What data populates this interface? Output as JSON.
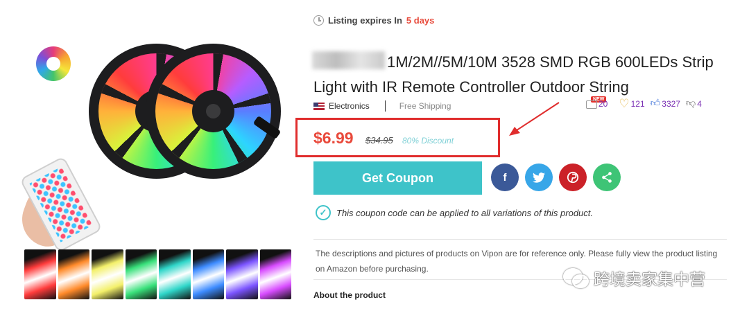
{
  "listing": {
    "expiry_label": "Listing expires In",
    "expiry_days": "5 days"
  },
  "product": {
    "title": "1M/2M//5M/10M 3528 SMD RGB 600LEDs Strip Light with IR Remote Controller Outdoor String",
    "category": "Electronics",
    "shipping": "Free Shipping"
  },
  "stats": {
    "comments": "20",
    "new_badge": "NEW",
    "favorites": "121",
    "likes": "3327",
    "dislikes": "4"
  },
  "pricing": {
    "price": "$6.99",
    "original_price": "$34.95",
    "discount": "80% Discount"
  },
  "actions": {
    "coupon_label": "Get Coupon",
    "share": {
      "facebook": "f",
      "twitter": "🐦",
      "pinterest": "℗",
      "share": "<"
    }
  },
  "notes": {
    "coupon_note": "This coupon code can be applied to all variations of this product.",
    "disclaimer": "The descriptions and pictures of products on Vipon are for reference only. Please fully view the product listing on Amazon before purchasing.",
    "about_heading": "About the product"
  },
  "watermark": {
    "text": "跨境卖家集中营"
  },
  "colors": {
    "accent_teal": "#3ec3c9",
    "price_red": "#e9493b",
    "highlight_box": "#e02d2d",
    "strip_swatches": [
      "#ff3b3b",
      "#ff8a2a",
      "#f3f06a",
      "#38e07a",
      "#2fd6c9",
      "#3d8bff",
      "#7b54ff",
      "#d84cff"
    ]
  }
}
